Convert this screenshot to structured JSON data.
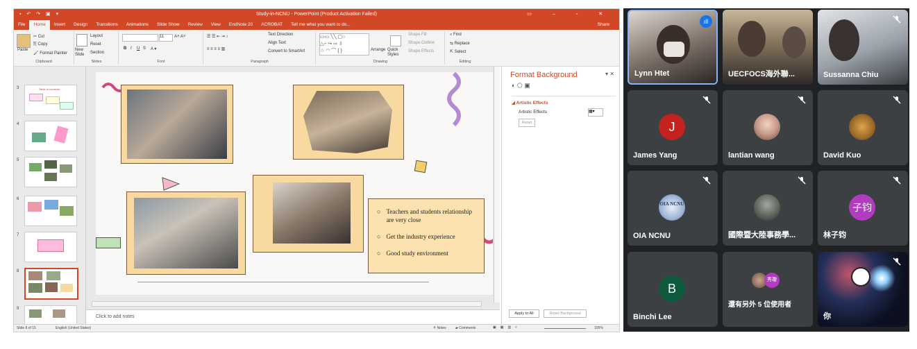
{
  "ppt": {
    "title": "Study-in-NCNU - PowerPoint (Product Activation Failed)",
    "tabs": [
      "File",
      "Home",
      "Insert",
      "Design",
      "Transitions",
      "Animations",
      "Slide Show",
      "Review",
      "View",
      "EndNote 20",
      "ACROBAT",
      "Tell me what you want to do..."
    ],
    "share": "Share",
    "ribbon": {
      "clipboard": {
        "paste": "Paste",
        "cut": "Cut",
        "copy": "Copy",
        "format_painter": "Format Painter",
        "label": "Clipboard"
      },
      "slides": {
        "new_slide": "New Slide",
        "layout": "Layout",
        "reset": "Reset",
        "section": "Section",
        "label": "Slides"
      },
      "font": {
        "label": "Font",
        "size": "11",
        "bold": "B",
        "italic": "I",
        "underline": "U",
        "strike": "S"
      },
      "paragraph": {
        "text_direction": "Text Direction",
        "align_text": "Align Text",
        "smartart": "Convert to SmartArt",
        "label": "Paragraph"
      },
      "drawing": {
        "arrange": "Arrange",
        "quick_styles": "Quick Styles",
        "shape_fill": "Shape Fill",
        "shape_outline": "Shape Outline",
        "shape_effects": "Shape Effects",
        "label": "Drawing"
      },
      "editing": {
        "find": "Find",
        "replace": "Replace",
        "select": "Select",
        "label": "Editing"
      }
    },
    "thumb_numbers": [
      "3",
      "4",
      "5",
      "6",
      "7",
      "8",
      "9"
    ],
    "thumb3_text": "Table of contents",
    "slide": {
      "bullets": [
        "Teachers and students relationship are very close",
        "Get the industry experience",
        "Good study environment"
      ]
    },
    "notes_placeholder": "Click to add notes",
    "format_pane": {
      "title": "Format Background",
      "section": "Artistic Effects",
      "row_label": "Artistic Effects",
      "reset": "Reset",
      "apply_all": "Apply to All",
      "reset_background": "Reset Background"
    },
    "status": {
      "slide": "Slide 8 of 15",
      "language": "English (United States)",
      "notes": "Notes",
      "comments": "Comments",
      "zoom": "105%"
    }
  },
  "meet": {
    "participants": [
      {
        "name": "Lynn Htet",
        "type": "video",
        "speaking": true
      },
      {
        "name": "UECFOCS海外聯...",
        "type": "video"
      },
      {
        "name": "Sussanna Chiu",
        "type": "video"
      },
      {
        "name": "James Yang",
        "type": "initial",
        "initial": "J",
        "color": "#c5221f"
      },
      {
        "name": "lantian wang",
        "type": "photo"
      },
      {
        "name": "David Kuo",
        "type": "photo"
      },
      {
        "name": "OIA NCNU",
        "type": "photo",
        "logo_text": "OIA NCNU"
      },
      {
        "name": "國際暨大陸事務學...",
        "type": "photo"
      },
      {
        "name": "林子钧",
        "type": "initial",
        "initial": "子钧",
        "color": "#b13cbf"
      },
      {
        "name": "Binchi Lee",
        "type": "initial",
        "initial": "B",
        "color": "#0d5a3e"
      },
      {
        "name": "還有另外 5 位使用者",
        "type": "others",
        "badge": "秀瓊"
      },
      {
        "name": "你",
        "type": "self"
      }
    ]
  },
  "colors": {
    "ppt_accent": "#d24726",
    "meet_bg": "#202124",
    "tile_bg": "#3c4043"
  }
}
